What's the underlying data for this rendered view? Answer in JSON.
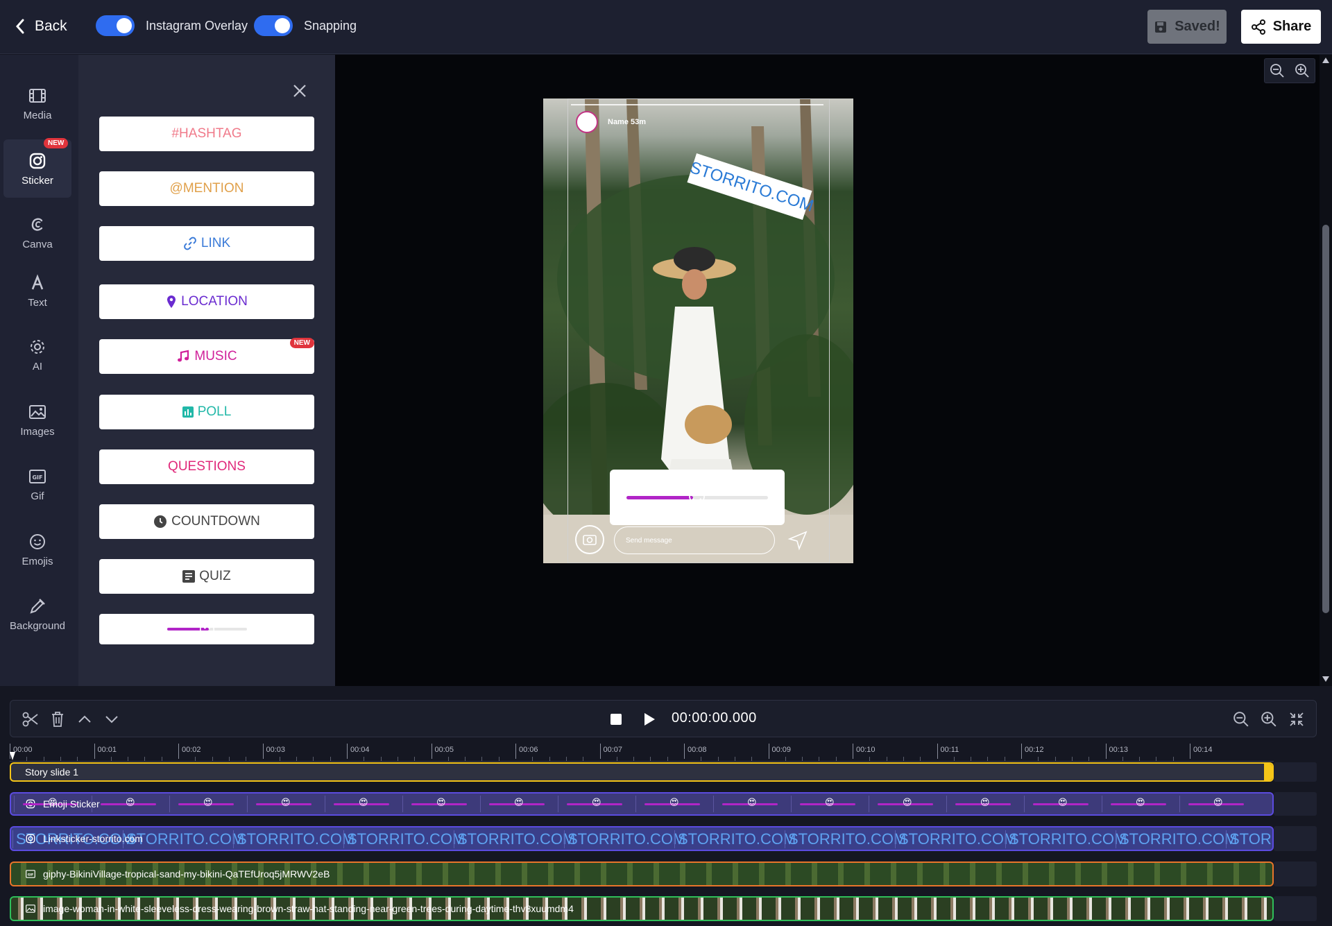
{
  "topbar": {
    "back_label": "Back",
    "toggle_instagram_label": "Instagram Overlay",
    "toggle_snapping_label": "Snapping",
    "saved_label": "Saved!",
    "share_label": "Share"
  },
  "leftnav": {
    "items": [
      {
        "label": "Media",
        "icon": "film-icon"
      },
      {
        "label": "Sticker",
        "icon": "instagram-icon",
        "badge": "NEW"
      },
      {
        "label": "Canva",
        "icon": "canva-icon"
      },
      {
        "label": "Text",
        "icon": "text-icon"
      },
      {
        "label": "AI",
        "icon": "gear-icon"
      },
      {
        "label": "Images",
        "icon": "image-icon"
      },
      {
        "label": "Gif",
        "icon": "gif-icon"
      },
      {
        "label": "Emojis",
        "icon": "smile-icon"
      },
      {
        "label": "Background",
        "icon": "eyedropper-icon"
      }
    ]
  },
  "stickers": {
    "hashtag": "#HASHTAG",
    "mention": "@MENTION",
    "link": "LINK",
    "location": "LOCATION",
    "music": "MUSIC",
    "music_badge": "NEW",
    "poll": "POLL",
    "questions": "QUESTIONS",
    "countdown": "COUNTDOWN",
    "quiz": "QUIZ",
    "slider_emoji": "😍"
  },
  "preview": {
    "username": "Name 53m",
    "link_sticker": "STORRITO.COM",
    "slider_emoji": "😍",
    "send_message": "Send message"
  },
  "timeline": {
    "time": "00:00:00.000",
    "ticks": [
      "00:00",
      "00:01",
      "00:02",
      "00:03",
      "00:04",
      "00:05",
      "00:06",
      "00:07",
      "00:08",
      "00:09",
      "00:10",
      "00:11",
      "00:12",
      "00:13",
      "00:14"
    ],
    "tracks": [
      {
        "label": "Story slide 1",
        "color": "#f5c518"
      },
      {
        "label": "Emoji Sticker",
        "color": "#5b4be0"
      },
      {
        "label": "Linksticker-storrito.com",
        "color": "#5b4be0"
      },
      {
        "label": "giphy-BikiniVillage-tropical-sand-my-bikini-QaTEfUroq5jMRWV2eB",
        "color": "#e8752a"
      },
      {
        "label": "image-woman-in-white-sleeveless-dress-wearing-brown-straw-hat-standing-near-green-trees-during-daytime-thv8xuumdm4",
        "color": "#2fbf5a"
      }
    ],
    "link_repeat": "STORRITO.COM"
  },
  "colors": {
    "accent_blue": "#2f6cf0",
    "hashtag": "#f07a8a",
    "mention": "#e0a04a",
    "link": "#3b7bd8",
    "location": "#6a2bd0",
    "music": "#d0219a",
    "poll": "#22b8a8",
    "questions": "#e0287a",
    "countdown": "#444444",
    "quiz": "#444444"
  }
}
